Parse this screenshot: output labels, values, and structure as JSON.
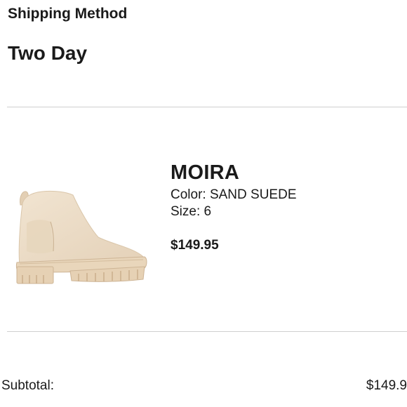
{
  "shipping": {
    "heading": "Shipping Method",
    "method": "Two Day"
  },
  "product": {
    "name": "MOIRA",
    "color_line": "Color: SAND SUEDE",
    "size_line": "Size: 6",
    "price": "$149.95",
    "image_icon": "chelsea-boot-image",
    "image_color": "#ecdcc6"
  },
  "totals": {
    "subtotal_label": "Subtotal:",
    "subtotal_value": "$149.9"
  }
}
